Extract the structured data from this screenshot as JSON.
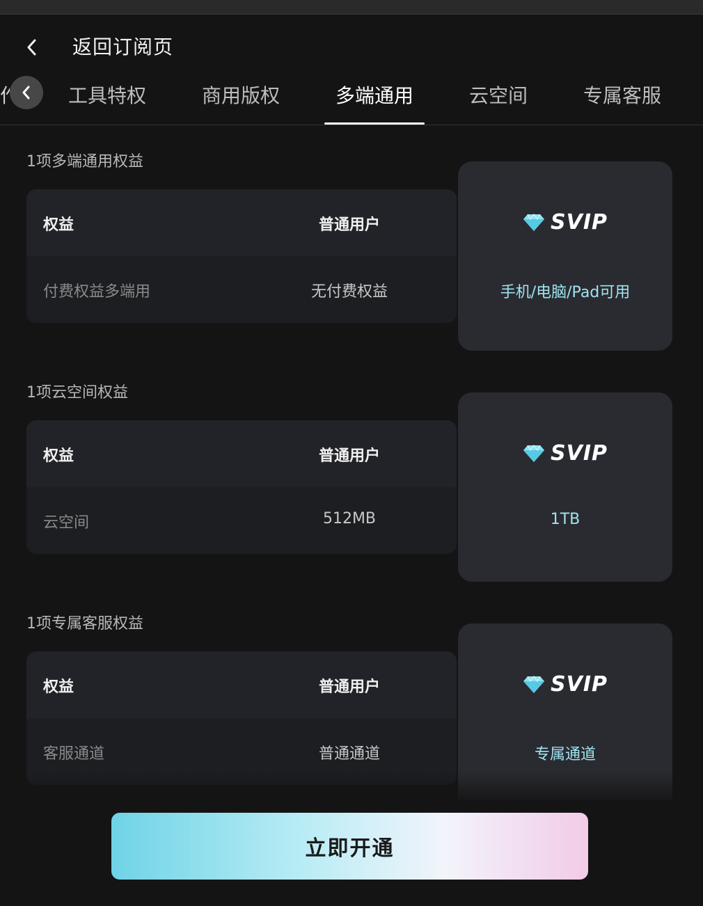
{
  "header": {
    "title": "返回订阅页"
  },
  "tabs": {
    "partial_label": "作",
    "items": [
      {
        "label": "工具特权"
      },
      {
        "label": "商用版权"
      },
      {
        "label": "多端通用"
      },
      {
        "label": "云空间"
      },
      {
        "label": "专属客服"
      }
    ],
    "active_index": 2
  },
  "sections": [
    {
      "title": "1项多端通用权益",
      "header_left": "权益",
      "header_mid": "普通用户",
      "row_left": "付费权益多端用",
      "row_mid": "无付费权益",
      "svip_label": "SVIP",
      "svip_value": "手机/电脑/Pad可用"
    },
    {
      "title": "1项云空间权益",
      "header_left": "权益",
      "header_mid": "普通用户",
      "row_left": "云空间",
      "row_mid": "512MB",
      "svip_label": "SVIP",
      "svip_value": "1TB"
    },
    {
      "title": "1项专属客服权益",
      "header_left": "权益",
      "header_mid": "普通用户",
      "row_left": "客服通道",
      "row_mid": "普通通道",
      "svip_label": "SVIP",
      "svip_value": "专属通道"
    }
  ],
  "cta": {
    "label": "立即开通"
  },
  "icons": {
    "back": "chevron-left-icon",
    "tab_scroll": "chevron-left-icon",
    "svip": "diamond-icon"
  },
  "colors": {
    "background": "#141414",
    "accent_text": "#9fe4f0",
    "cta_gradient": [
      "#6fd3e6",
      "#b8ecf5",
      "#f2f4fb",
      "#f2cbe8"
    ]
  }
}
